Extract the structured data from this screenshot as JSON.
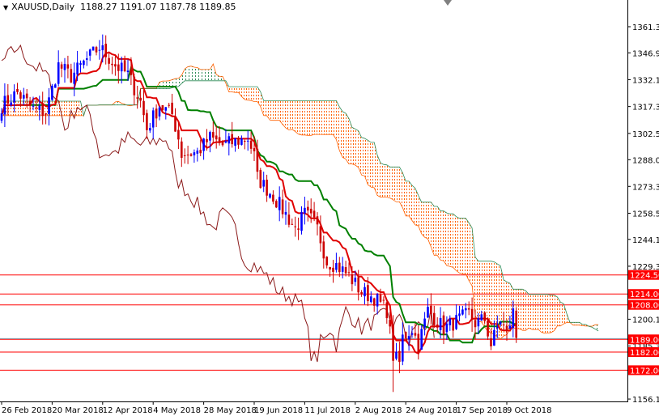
{
  "header": {
    "symbol_timeframe": "XAUUSD,Daily",
    "ohlc": "1188.27 1191.07 1187.78 1189.85"
  },
  "chart_data": {
    "type": "candlestick",
    "indicator": "Ichimoku Kinko Hyo (9, 26, 52)",
    "ylim": [
      1150,
      1372
    ],
    "y_ticks": [
      "1361.30",
      "1346.90",
      "1332.10",
      "1317.30",
      "1302.50",
      "1288.00",
      "1273.30",
      "1258.50",
      "1244.10",
      "1229.30",
      "1200.10",
      "1185.30",
      "1156.10"
    ],
    "x_ticks": [
      {
        "bar": 0,
        "label": "26 Feb 2018"
      },
      {
        "bar": 16,
        "label": "20 Mar 2018"
      },
      {
        "bar": 32,
        "label": "12 Apr 2018"
      },
      {
        "bar": 48,
        "label": "4 May 2018"
      },
      {
        "bar": 64,
        "label": "28 May 2018"
      },
      {
        "bar": 80,
        "label": "19 Jun 2018"
      },
      {
        "bar": 96,
        "label": "11 Jul 2018"
      },
      {
        "bar": 112,
        "label": "2 Aug 2018"
      },
      {
        "bar": 128,
        "label": "24 Aug 2018"
      },
      {
        "bar": 144,
        "label": "17 Sep 2018"
      },
      {
        "bar": 160,
        "label": "9 Oct 2018"
      }
    ],
    "close_anchors": [
      [
        0,
        1318
      ],
      [
        5,
        1325
      ],
      [
        10,
        1316
      ],
      [
        14,
        1314
      ],
      [
        18,
        1340
      ],
      [
        22,
        1334
      ],
      [
        28,
        1345
      ],
      [
        31,
        1350
      ],
      [
        36,
        1340
      ],
      [
        40,
        1335
      ],
      [
        44,
        1320
      ],
      [
        46,
        1305
      ],
      [
        50,
        1318
      ],
      [
        54,
        1313
      ],
      [
        56,
        1300
      ],
      [
        57,
        1291
      ],
      [
        62,
        1292
      ],
      [
        66,
        1300
      ],
      [
        70,
        1296
      ],
      [
        74,
        1298
      ],
      [
        78,
        1300
      ],
      [
        80,
        1290
      ],
      [
        81,
        1278
      ],
      [
        86,
        1268
      ],
      [
        90,
        1258
      ],
      [
        93,
        1250
      ],
      [
        96,
        1258
      ],
      [
        98,
        1255
      ],
      [
        100,
        1250
      ],
      [
        103,
        1232
      ],
      [
        106,
        1230
      ],
      [
        110,
        1224
      ],
      [
        114,
        1215
      ],
      [
        118,
        1212
      ],
      [
        122,
        1205
      ],
      [
        124,
        1180
      ],
      [
        126,
        1176
      ],
      [
        127,
        1190
      ],
      [
        130,
        1195
      ],
      [
        132,
        1186
      ],
      [
        135,
        1205
      ],
      [
        140,
        1195
      ],
      [
        145,
        1200
      ],
      [
        148,
        1203
      ],
      [
        150,
        1198
      ],
      [
        153,
        1200
      ],
      [
        155,
        1186
      ],
      [
        158,
        1200
      ],
      [
        160,
        1192
      ],
      [
        162,
        1204
      ],
      [
        163,
        1189.85
      ]
    ],
    "spike_low": {
      "bar": 124,
      "low": 1160
    },
    "levels": [
      {
        "price": 1224.5,
        "label": "1224.50"
      },
      {
        "price": 1214.0,
        "label": "1214.00"
      },
      {
        "price": 1208.0,
        "label": "1208.00"
      },
      {
        "price": 1189.0,
        "label": "1189.00"
      },
      {
        "price": 1182.0,
        "label": "1182.00"
      },
      {
        "price": 1172.0,
        "label": "1172.00"
      }
    ],
    "bid": 1189.85,
    "colors": {
      "bull": "#0000ff",
      "bear": "#cc0000",
      "tenkan": "#e00000",
      "kijun": "#008000",
      "chikou": "#8b1a1a",
      "cloud_up": "#2e8b57",
      "cloud_down": "#ff6000",
      "level": "#ff0000"
    }
  }
}
